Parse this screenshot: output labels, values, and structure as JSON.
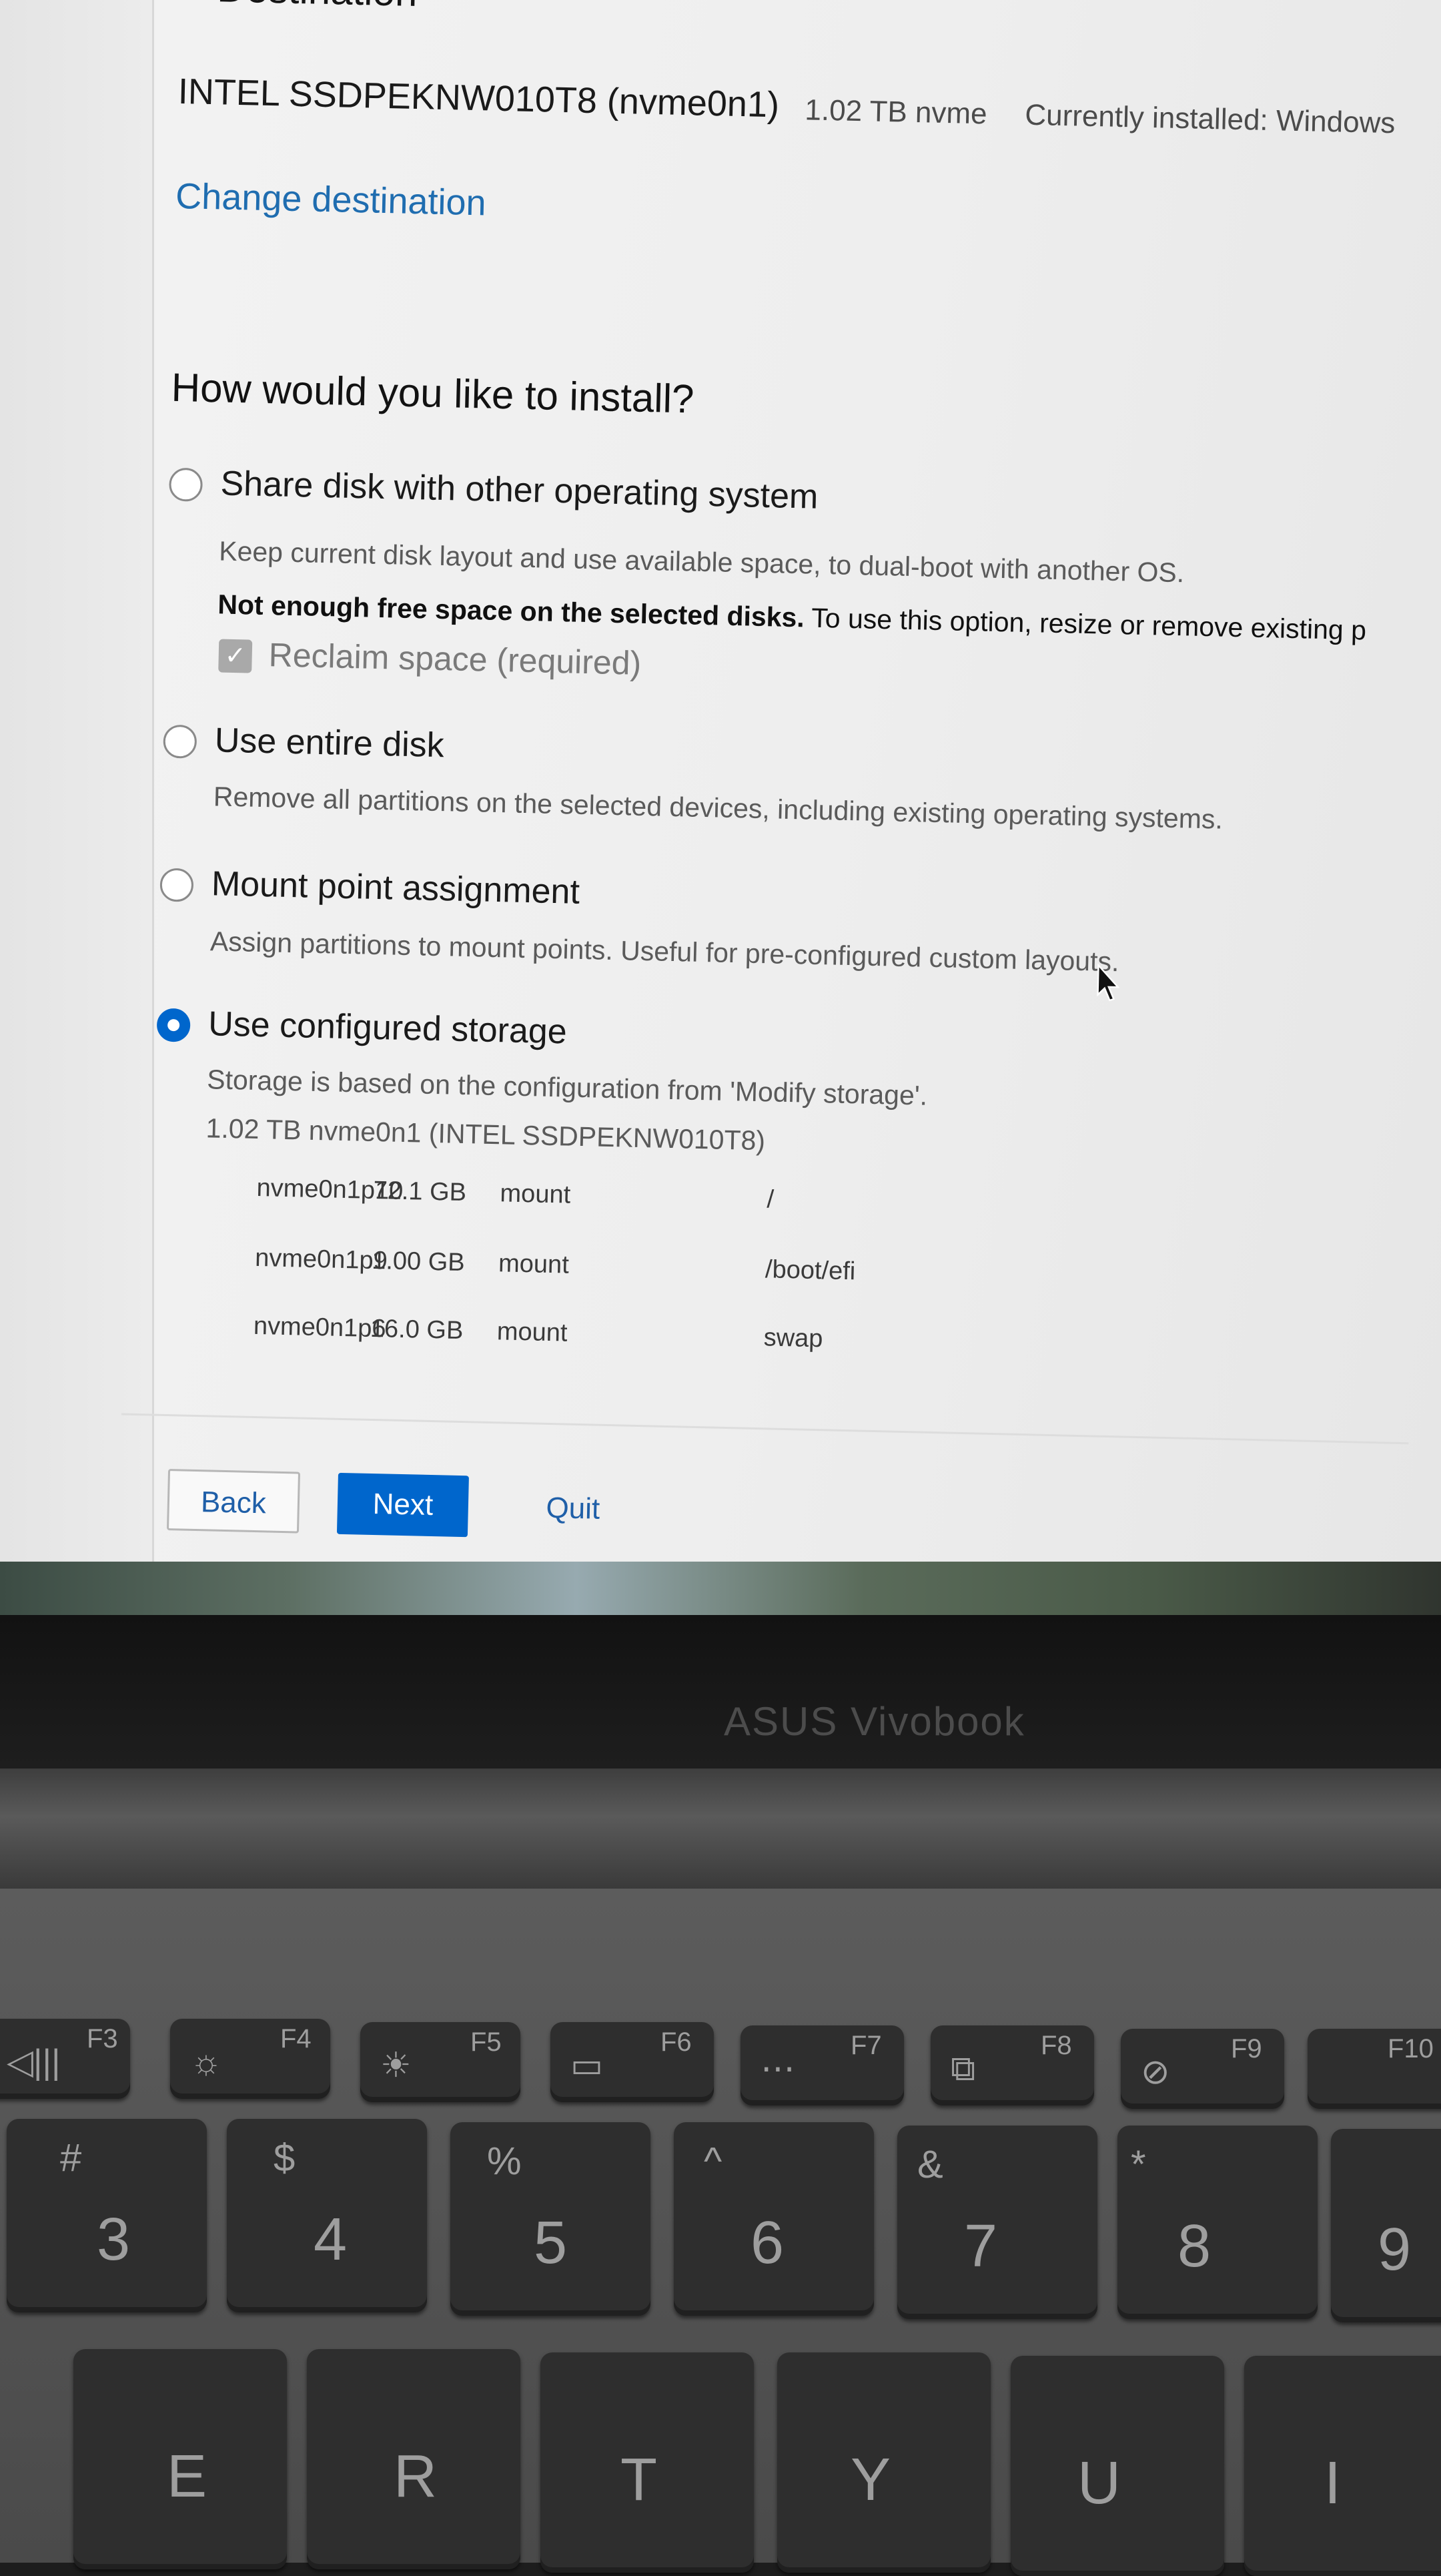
{
  "installer": {
    "destination_heading_partial": "Destination",
    "disk": {
      "model": "INTEL SSDPEKNW010T8 (nvme0n1)",
      "size": "1.02 TB nvme",
      "status": "Currently installed: Windows"
    },
    "change_destination_label": "Change destination",
    "question": "How would you like to install?",
    "options": [
      {
        "label": "Share disk with other operating system",
        "description": "Keep current disk layout and use available space, to dual-boot with another OS.",
        "selected": false
      },
      {
        "label": "Use entire disk",
        "description": "Remove all partitions on the selected devices, including existing operating systems.",
        "selected": false
      },
      {
        "label": "Mount point assignment",
        "description": "Assign partitions to mount points. Useful for pre-configured custom layouts.",
        "selected": false
      },
      {
        "label": "Use configured storage",
        "description": "Storage is based on the configuration from 'Modify storage'.",
        "selected": true
      }
    ],
    "warning": {
      "bold": "Not enough free space on the selected disks.",
      "rest": " To use this option, resize or remove existing p"
    },
    "reclaim": {
      "label": "Reclaim space (required)",
      "checked": true
    },
    "storage_disk": "1.02 TB nvme0n1 (INTEL SSDPEKNW010T8)",
    "partitions": [
      {
        "name": "nvme0n1p10",
        "size": "72.1 GB",
        "action": "mount",
        "mount_point": "/"
      },
      {
        "name": "nvme0n1p9",
        "size": "1.00 GB",
        "action": "mount",
        "mount_point": "/boot/efi"
      },
      {
        "name": "nvme0n1p6",
        "size": "16.0 GB",
        "action": "mount",
        "mount_point": "swap"
      }
    ],
    "buttons": {
      "back": "Back",
      "next": "Next",
      "quit": "Quit"
    },
    "colors": {
      "accent": "#0066cc",
      "link": "#1f6db0"
    }
  },
  "laptop": {
    "brand": "ASUS Vivobook",
    "fn_keys": [
      {
        "label": "F3",
        "icon": "mute-icon"
      },
      {
        "label": "F4",
        "icon": "brightness-down-icon"
      },
      {
        "label": "F5",
        "icon": "brightness-up-icon"
      },
      {
        "label": "F6",
        "icon": "touchpad-icon"
      },
      {
        "label": "F7",
        "icon": "keyboard-backlight-icon"
      },
      {
        "label": "F8",
        "icon": "display-switch-icon"
      },
      {
        "label": "F9",
        "icon": "mic-mute-icon"
      },
      {
        "label": "F10",
        "icon": ""
      }
    ],
    "number_keys": [
      {
        "main": "3",
        "shift": "#"
      },
      {
        "main": "4",
        "shift": "$"
      },
      {
        "main": "5",
        "shift": "%"
      },
      {
        "main": "6",
        "shift": "^"
      },
      {
        "main": "7",
        "shift": "&"
      },
      {
        "main": "8",
        "shift": "*"
      },
      {
        "main": "9",
        "shift": ""
      }
    ],
    "letter_keys": [
      "E",
      "R",
      "T",
      "Y",
      "U",
      "I"
    ]
  }
}
